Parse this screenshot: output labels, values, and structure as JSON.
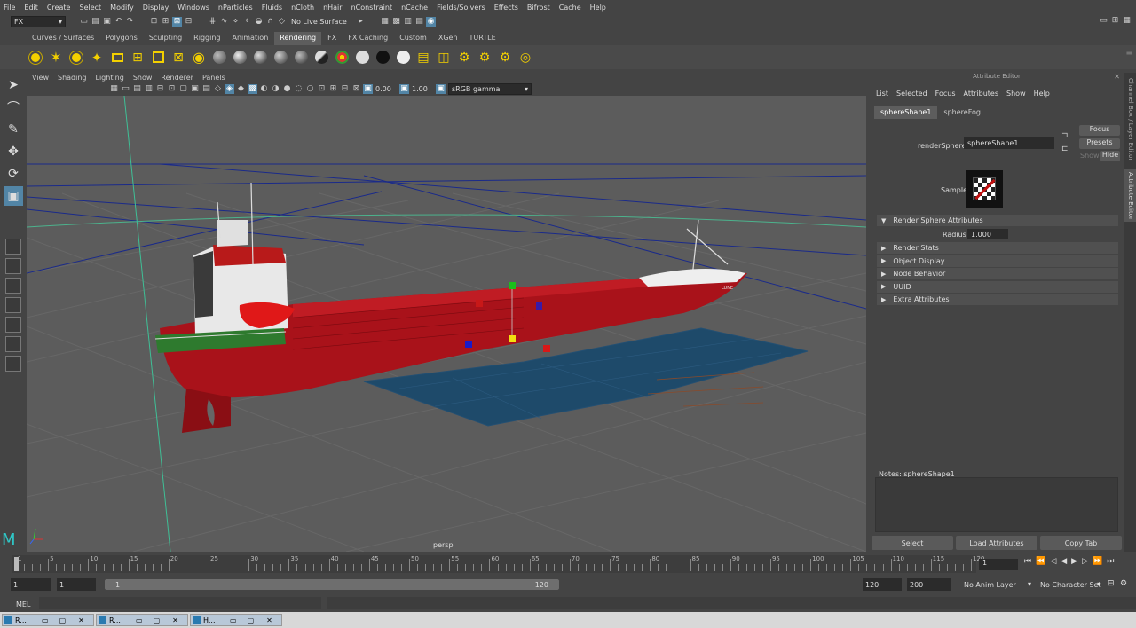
{
  "menubar": [
    "File",
    "Edit",
    "Create",
    "Select",
    "Modify",
    "Display",
    "Windows",
    "nParticles",
    "Fluids",
    "nCloth",
    "nHair",
    "nConstraint",
    "nCache",
    "Fields/Solvers",
    "Effects",
    "Bifrost",
    "Cache",
    "Help"
  ],
  "status": {
    "mode": "FX",
    "live_surface": "No Live Surface"
  },
  "shelf_tabs": [
    "Curves / Surfaces",
    "Polygons",
    "Sculpting",
    "Rigging",
    "Animation",
    "Rendering",
    "FX",
    "FX Caching",
    "Custom",
    "XGen",
    "TURTLE"
  ],
  "shelf_active": "Rendering",
  "viewport": {
    "menu": [
      "View",
      "Shading",
      "Lighting",
      "Show",
      "Renderer",
      "Panels"
    ],
    "exposure": "0.00",
    "gamma": "1.00",
    "color_space": "sRGB gamma",
    "camera_label": "persp",
    "ship_text": "LUNE"
  },
  "attr": {
    "title": "Attribute Editor",
    "menu": [
      "List",
      "Selected",
      "Focus",
      "Attributes",
      "Show",
      "Help"
    ],
    "tabs": [
      "sphereShape1",
      "sphereFog"
    ],
    "focus_btn": "Focus",
    "presets_btn": "Presets",
    "show_btn": "Show",
    "hide_btn": "Hide",
    "node_label": "renderSphere:",
    "node_value": "sphereShape1",
    "sample_label": "Sample",
    "section_open": "Render Sphere Attributes",
    "radius_label": "Radius",
    "radius_value": "1.000",
    "sections": [
      "Render Stats",
      "Object Display",
      "Node Behavior",
      "UUID",
      "Extra Attributes"
    ],
    "notes_label": "Notes:  sphereShape1",
    "bottom_buttons": [
      "Select",
      "Load Attributes",
      "Copy Tab"
    ],
    "side_tabs": [
      "Channel Box / Layer Editor",
      "Attribute Editor"
    ]
  },
  "timeline": {
    "ticks": [
      "1",
      "5",
      "10",
      "15",
      "20",
      "25",
      "30",
      "35",
      "40",
      "45",
      "50",
      "55",
      "60",
      "65",
      "70",
      "75",
      "80",
      "85",
      "90",
      "95",
      "100",
      "105",
      "110",
      "115",
      "120"
    ],
    "current": "1"
  },
  "range": {
    "start": "1",
    "start2": "1",
    "slider_start": "1",
    "slider_end": "120",
    "end": "120",
    "end2": "200",
    "anim_layer": "No Anim Layer",
    "char_set": "No Character Set"
  },
  "cmd": {
    "label": "MEL"
  },
  "taskbar": [
    "R...",
    "R...",
    "H..."
  ]
}
